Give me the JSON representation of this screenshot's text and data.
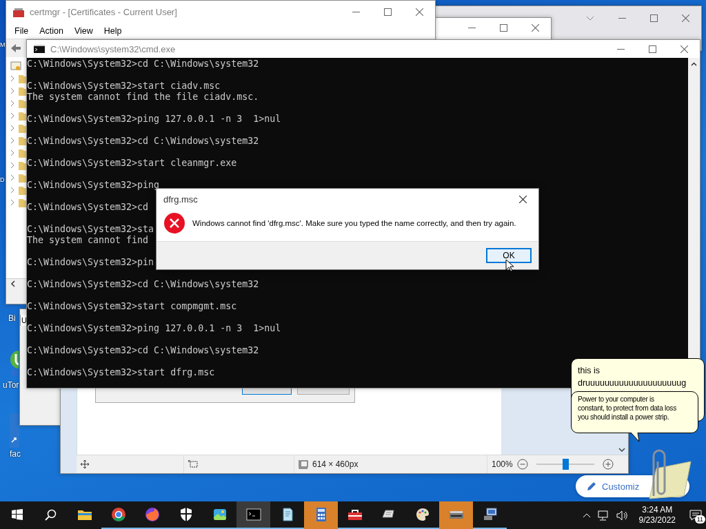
{
  "desktop_icons": [
    {
      "label": "M"
    },
    {
      "label": "D"
    },
    {
      "label": "Bi"
    },
    {
      "label": "uTor"
    },
    {
      "label": "fac"
    }
  ],
  "certmgr": {
    "title": "certmgr - [Certificates - Current User]",
    "menu": [
      "File",
      "Action",
      "View",
      "Help"
    ]
  },
  "partial_window": {
    "text": "U"
  },
  "paint": {
    "size": "614 × 460px",
    "zoom": "100%",
    "zoom_slider": {
      "level": 0.5
    }
  },
  "cmd": {
    "title": "C:\\Windows\\system32\\cmd.exe",
    "entries": [
      [
        "C:\\Windows\\System32>cd C:\\Windows\\system32"
      ],
      [
        "C:\\Windows\\System32>start ciadv.msc",
        "The system cannot find the file ciadv.msc."
      ],
      [
        "C:\\Windows\\System32>ping 127.0.0.1 -n 3  1>nul"
      ],
      [
        "C:\\Windows\\System32>cd C:\\Windows\\system32"
      ],
      [
        "C:\\Windows\\System32>start cleanmgr.exe"
      ],
      [
        "C:\\Windows\\System32>ping"
      ],
      [
        "C:\\Windows\\System32>cd"
      ],
      [
        "C:\\Windows\\System32>sta",
        "The system cannot find"
      ],
      [
        "C:\\Windows\\System32>pin"
      ],
      [
        "C:\\Windows\\System32>cd C:\\Windows\\system32"
      ],
      [
        "C:\\Windows\\System32>start compmgmt.msc"
      ],
      [
        "C:\\Windows\\System32>ping 127.0.0.1 -n 3  1>nul"
      ],
      [
        "C:\\Windows\\System32>cd C:\\Windows\\system32"
      ],
      [
        "C:\\Windows\\System32>start dfrg.msc"
      ]
    ]
  },
  "dialog": {
    "title": "dfrg.msc",
    "message": "Windows cannot find 'dfrg.msc'. Make sure you typed the name correctly, and then try again.",
    "button": "OK"
  },
  "assistant": {
    "bubble_1": [
      "this is",
      "druuuuuuuuuuuuuuuuuuuug"
    ],
    "bubble_2": [
      "Power to your computer is",
      "constant, to protect from data loss",
      "you should install a power strip."
    ],
    "customize": "Customiz"
  },
  "taskbar": {
    "apps": [
      {
        "running": false,
        "selected": false,
        "flashing": false
      },
      {
        "running": true,
        "selected": false,
        "flashing": false
      },
      {
        "running": true,
        "selected": false,
        "flashing": false
      },
      {
        "running": true,
        "selected": false,
        "flashing": false
      },
      {
        "running": true,
        "selected": false,
        "flashing": false
      },
      {
        "running": true,
        "selected": true,
        "flashing": false
      },
      {
        "running": true,
        "selected": false,
        "flashing": false
      },
      {
        "running": true,
        "selected": false,
        "flashing": true
      },
      {
        "running": true,
        "selected": false,
        "flashing": false
      },
      {
        "running": true,
        "selected": false,
        "flashing": false
      },
      {
        "running": true,
        "selected": false,
        "flashing": false
      },
      {
        "running": true,
        "selected": false,
        "flashing": true
      },
      {
        "running": true,
        "selected": false,
        "flashing": false
      }
    ],
    "time": "3:24 AM",
    "date": "9/23/2022",
    "notifications": "11"
  }
}
